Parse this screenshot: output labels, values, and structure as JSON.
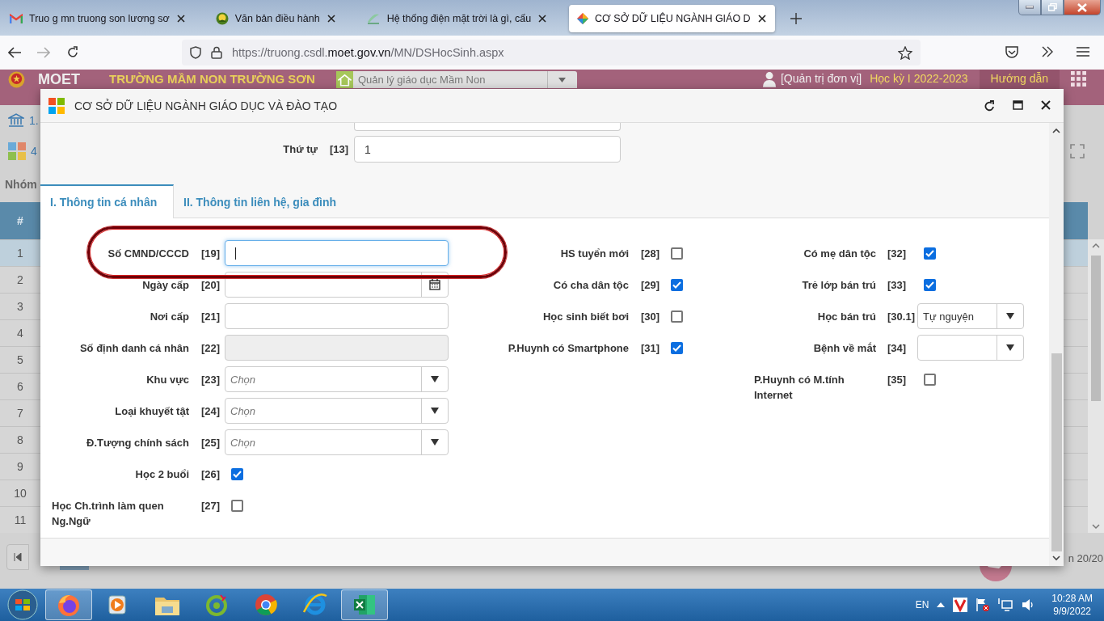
{
  "browser": {
    "tabs": [
      {
        "kind": "mail",
        "title": "Truo g mn truong son lương sơ",
        "selected": false
      },
      {
        "kind": "round",
        "title": "Văn bản điều hành",
        "selected": false
      },
      {
        "kind": "leaf",
        "title": "Hệ thống điện mặt trời là gì, cấu",
        "selected": false
      },
      {
        "kind": "diamond",
        "title": "CƠ SỞ DỮ LIỆU NGÀNH GIÁO D",
        "selected": true
      }
    ],
    "url": {
      "prefix": "https://truong.csdl.",
      "domain": "moet.gov.vn",
      "path": "/MN/DSHocSinh.aspx"
    }
  },
  "page": {
    "header": {
      "logo_text": "MOET",
      "school": "TRƯỜNG MẦM NON TRƯỜNG SƠN",
      "module": "Quản lý giáo dục Mầm Non",
      "role": "[Quản trị đơn vị]",
      "term": "Học kỳ I 2022-2023",
      "help": "Hướng dẫn"
    },
    "breadcrumb": "1.",
    "toolbar_count": "4",
    "group_label": "Nhóm",
    "table": {
      "header": "#",
      "rows": [
        {
          "number": "1",
          "selected": true
        },
        {
          "number": "2",
          "selected": false
        },
        {
          "number": "3",
          "selected": false
        },
        {
          "number": "4",
          "selected": false
        },
        {
          "number": "5",
          "selected": false
        },
        {
          "number": "6",
          "selected": false
        },
        {
          "number": "7",
          "selected": false
        },
        {
          "number": "8",
          "selected": false
        },
        {
          "number": "9",
          "selected": false
        },
        {
          "number": "10",
          "selected": false
        },
        {
          "number": "11",
          "selected": false
        }
      ]
    },
    "pager": "n 20/20"
  },
  "modal": {
    "title": "CƠ SỞ DỮ LIỆU NGÀNH GIÁO DỤC VÀ ĐÀO TẠO",
    "order": {
      "label": "Thứ tự",
      "code": "[13]",
      "value": "1"
    },
    "tabs": [
      {
        "label": "I. Thông tin cá nhân",
        "selected": true
      },
      {
        "label": "II. Thông tin liên hệ, gia đình",
        "selected": false
      }
    ],
    "columns": [
      [
        {
          "kind": "text",
          "label": "Số CMND/CCCD",
          "code": "[19]",
          "focused": true
        },
        {
          "kind": "date",
          "label": "Ngày cấp",
          "code": "[20]"
        },
        {
          "kind": "text",
          "label": "Nơi cấp",
          "code": "[21]",
          "focused": false
        },
        {
          "kind": "readonly",
          "label": "Số định danh cá nhân",
          "code": "[22]"
        },
        {
          "kind": "select",
          "label": "Khu vực",
          "code": "[23]",
          "placeholder": "Chọn"
        },
        {
          "kind": "select",
          "label": "Loại khuyết tật",
          "code": "[24]",
          "placeholder": "Chọn"
        },
        {
          "kind": "select",
          "label": "Đ.Tượng chính sách",
          "code": "[25]",
          "placeholder": "Chọn"
        },
        {
          "kind": "checkbox",
          "label": "Học 2 buổi",
          "code": "[26]",
          "checked": true
        },
        {
          "kind": "checkbox",
          "label": "Học Ch.trình làm quen Ng.Ngữ",
          "code": "[27]",
          "checked": false
        }
      ],
      [
        {
          "kind": "checkbox",
          "label": "HS tuyển mới",
          "code": "[28]",
          "checked": false
        },
        {
          "kind": "checkbox",
          "label": "Có cha dân tộc",
          "code": "[29]",
          "checked": true
        },
        {
          "kind": "checkbox",
          "label": "Học sinh biết bơi",
          "code": "[30]",
          "checked": false
        },
        {
          "kind": "checkbox",
          "label": "P.Huynh có Smartphone",
          "code": "[31]",
          "checked": true
        }
      ],
      [
        {
          "kind": "checkbox",
          "label": "Có mẹ dân tộc",
          "code": "[32]",
          "checked": true
        },
        {
          "kind": "checkbox",
          "label": "Trẻ lớp bán trú",
          "code": "[33]",
          "checked": true
        },
        {
          "kind": "select",
          "label": "Học bán trú",
          "code": "[30.1]",
          "value": "Tự nguyện"
        },
        {
          "kind": "select",
          "label": "Bệnh về mắt",
          "code": "[34]"
        },
        {
          "kind": "checkbox",
          "label": "P.Huynh có M.tính Internet",
          "code": "[35]",
          "checked": false
        }
      ]
    ]
  },
  "taskbar": {
    "apps": [
      {
        "kind": "firefox",
        "open": true
      },
      {
        "kind": "media",
        "open": false
      },
      {
        "kind": "folder",
        "open": false
      },
      {
        "kind": "ring",
        "open": false
      },
      {
        "kind": "chrome",
        "open": false
      },
      {
        "kind": "ie",
        "open": false
      },
      {
        "kind": "sheet",
        "open": true
      }
    ],
    "language": "EN",
    "time": "10:28 AM",
    "date": "9/9/2022"
  }
}
